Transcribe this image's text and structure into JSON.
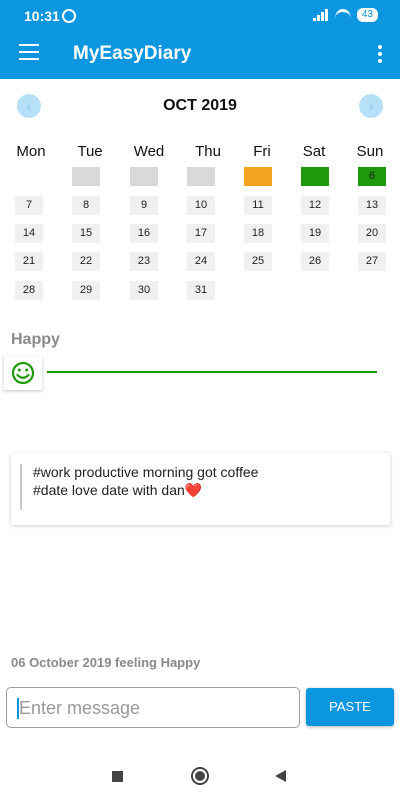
{
  "status_bar": {
    "time": "10:31",
    "battery": "43"
  },
  "app_bar": {
    "title": "MyEasyDiary"
  },
  "calendar": {
    "month_title": "OCT 2019",
    "prev_icon": "chevron-left-icon",
    "next_icon": "chevron-right-icon",
    "weekdays": [
      "Mon",
      "Tue",
      "Wed",
      "Thu",
      "Fri",
      "Sat",
      "Sun"
    ],
    "first_row_marks": {
      "orange": "#f3a31f",
      "green": "#1c9a09",
      "empty": "#d9d9d9"
    },
    "days": [
      "6",
      "7",
      "8",
      "9",
      "10",
      "11",
      "12",
      "13",
      "14",
      "15",
      "16",
      "17",
      "18",
      "19",
      "20",
      "21",
      "22",
      "23",
      "24",
      "25",
      "26",
      "27",
      "28",
      "29",
      "30",
      "31"
    ]
  },
  "mood": {
    "label": "Happy",
    "icon": "smiley-icon",
    "color": "#1c9a09"
  },
  "entry": {
    "text": "#work productive morning got coffee\n#date love date with dan❤️"
  },
  "feeling_summary": "06 October 2019 feeling Happy",
  "message": {
    "placeholder": "Enter message",
    "button_label": "PASTE"
  },
  "colors": {
    "accent": "#0d96e0"
  }
}
